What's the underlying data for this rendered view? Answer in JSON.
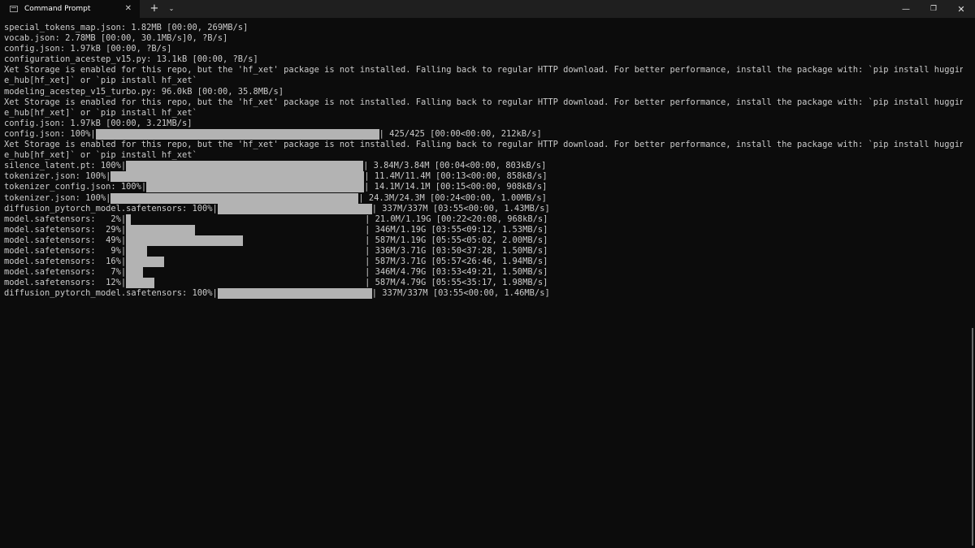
{
  "titlebar": {
    "tab_title": "Command Prompt",
    "tab_close": "✕",
    "new_tab": "+",
    "dropdown": "⌄",
    "minimize": "—",
    "maximize": "❐",
    "close": "✕",
    "icon": "terminal-icon"
  },
  "terminal": {
    "text_color": "#cccccc",
    "background": "#0c0c0c",
    "bar_color": "#b3b3b3",
    "lines": [
      "special_tokens_map.json: 1.82MB [00:00, 269MB/s]",
      "vocab.json: 2.78MB [00:00, 30.1MB/s]0, ?B/s]",
      "config.json: 1.97kB [00:00, ?B/s]",
      "configuration_acestep_v15.py: 13.1kB [00:00, ?B/s]",
      "Xet Storage is enabled for this repo, but the 'hf_xet' package is not installed. Falling back to regular HTTP download. For better performance, install the package with: `pip install huggingfac",
      "e_hub[hf_xet]` or `pip install hf_xet`",
      "modeling_acestep_v15_turbo.py: 96.0kB [00:00, 35.8MB/s]",
      "Xet Storage is enabled for this repo, but the 'hf_xet' package is not installed. Falling back to regular HTTP download. For better performance, install the package with: `pip install huggingfac",
      "e_hub[hf_xet]` or `pip install hf_xet`",
      "config.json: 1.97kB [00:00, 3.21MB/s]"
    ],
    "progress_config": {
      "prefix": "config.json: 100%|",
      "progress": 1.0,
      "suffix": "| 425/425 [00:00<00:00, 212kB/s]"
    },
    "xet_lines": [
      "Xet Storage is enabled for this repo, but the 'hf_xet' package is not installed. Falling back to regular HTTP download. For better performance, install the package with: `pip install huggingfac",
      "e_hub[hf_xet]` or `pip install hf_xet`"
    ],
    "progress_rows": [
      {
        "prefix": "silence_latent.pt: 100%|",
        "progress": 1.0,
        "suffix": "| 3.84M/3.84M [00:04<00:00, 803kB/s]"
      },
      {
        "prefix": "tokenizer.json: 100%|",
        "progress": 1.0,
        "suffix": "| 11.4M/11.4M [00:13<00:00, 858kB/s]"
      },
      {
        "prefix": "tokenizer_config.json: 100%|",
        "progress": 1.0,
        "suffix": "| 14.1M/14.1M [00:15<00:00, 908kB/s]"
      },
      {
        "prefix": "tokenizer.json: 100%|",
        "progress": 1.0,
        "suffix": "| 24.3M/24.3M [00:24<00:00, 1.00MB/s]"
      },
      {
        "prefix": "diffusion_pytorch_model.safetensors: 100%|",
        "progress": 1.0,
        "suffix": "| 337M/337M [03:55<00:00, 1.43MB/s]"
      },
      {
        "prefix": "model.safetensors:   2%|",
        "progress": 0.02,
        "suffix": "| 21.0M/1.19G [00:22<20:08, 968kB/s]"
      },
      {
        "prefix": "model.safetensors:  29%|",
        "progress": 0.29,
        "suffix": "| 346M/1.19G [03:55<09:12, 1.53MB/s]"
      },
      {
        "prefix": "model.safetensors:  49%|",
        "progress": 0.49,
        "suffix": "| 587M/1.19G [05:55<05:02, 2.00MB/s]"
      },
      {
        "prefix": "model.safetensors:   9%|",
        "progress": 0.09,
        "suffix": "| 336M/3.71G [03:50<37:28, 1.50MB/s]"
      },
      {
        "prefix": "model.safetensors:  16%|",
        "progress": 0.16,
        "suffix": "| 587M/3.71G [05:57<26:46, 1.94MB/s]"
      },
      {
        "prefix": "model.safetensors:   7%|",
        "progress": 0.07,
        "suffix": "| 346M/4.79G [03:53<49:21, 1.50MB/s]"
      },
      {
        "prefix": "model.safetensors:  12%|",
        "progress": 0.12,
        "suffix": "| 587M/4.79G [05:55<35:17, 1.98MB/s]"
      },
      {
        "prefix": "diffusion_pytorch_model.safetensors: 100%|",
        "progress": 1.0,
        "suffix": "| 337M/337M [03:55<00:00, 1.46MB/s]"
      }
    ]
  }
}
